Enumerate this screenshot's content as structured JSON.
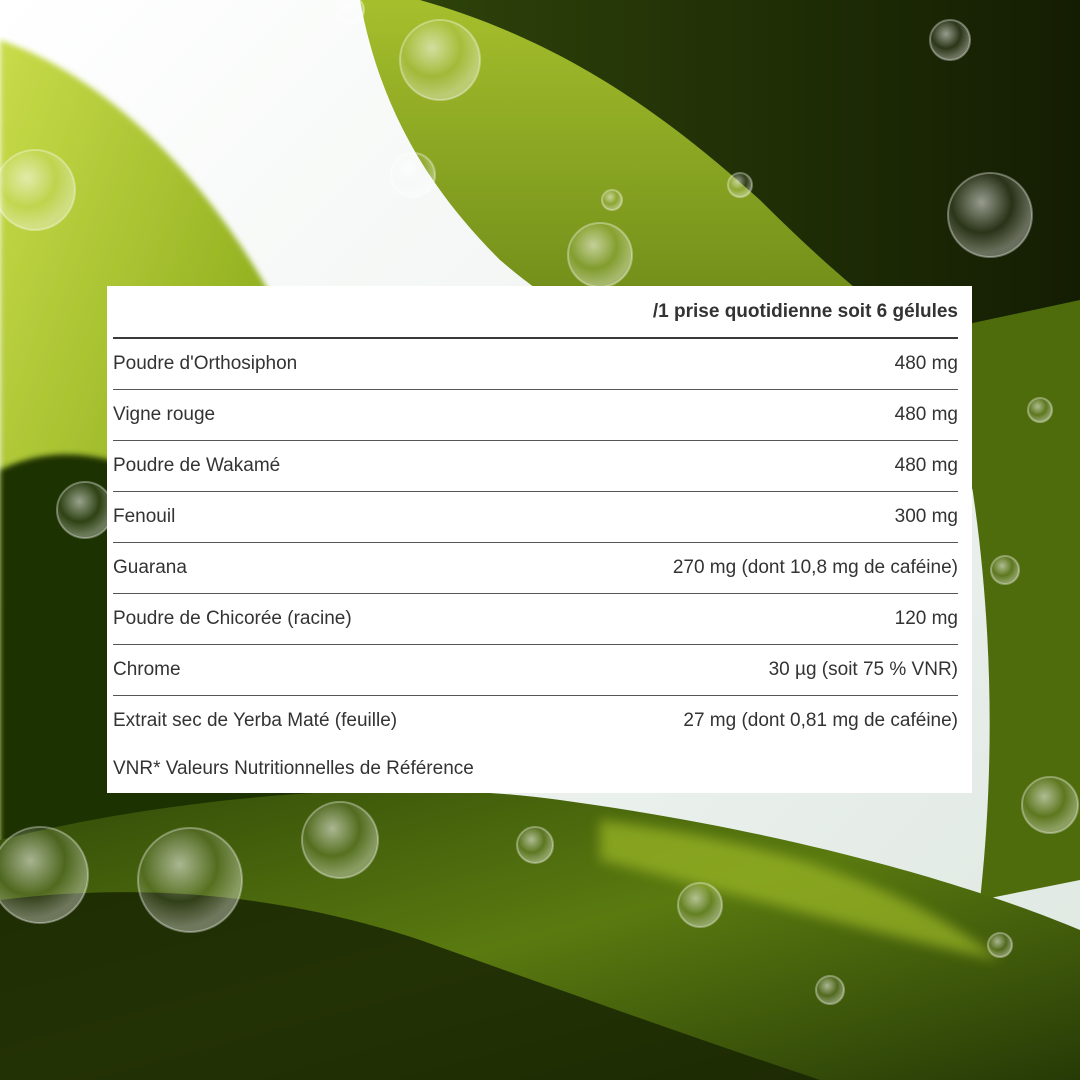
{
  "table": {
    "header": "/1 prise quotidienne soit 6 gélules",
    "rows": [
      {
        "name": "Poudre d'Orthosiphon",
        "value": "480 mg"
      },
      {
        "name": "Vigne rouge",
        "value": "480 mg"
      },
      {
        "name": "Poudre de Wakamé",
        "value": "480 mg"
      },
      {
        "name": "Fenouil",
        "value": "300 mg"
      },
      {
        "name": "Guarana",
        "value": "270 mg (dont 10,8 mg de caféine)"
      },
      {
        "name": "Poudre de Chicorée (racine)",
        "value": "120 mg"
      },
      {
        "name": "Chrome",
        "value": "30 µg (soit 75 % VNR)"
      },
      {
        "name": "Extrait sec de Yerba Maté (feuille)",
        "value": "27 mg (dont 0,81 mg de caféine)"
      }
    ],
    "footnote": "VNR* Valeurs Nutritionnelles de Référence"
  },
  "colors": {
    "text": "#333333",
    "card_bg": "#ffffff",
    "seaweed_dark": "#1f2c06",
    "seaweed_mid": "#5d7a12",
    "seaweed_light": "#b9cf3a",
    "sky": "#eef3ef"
  }
}
